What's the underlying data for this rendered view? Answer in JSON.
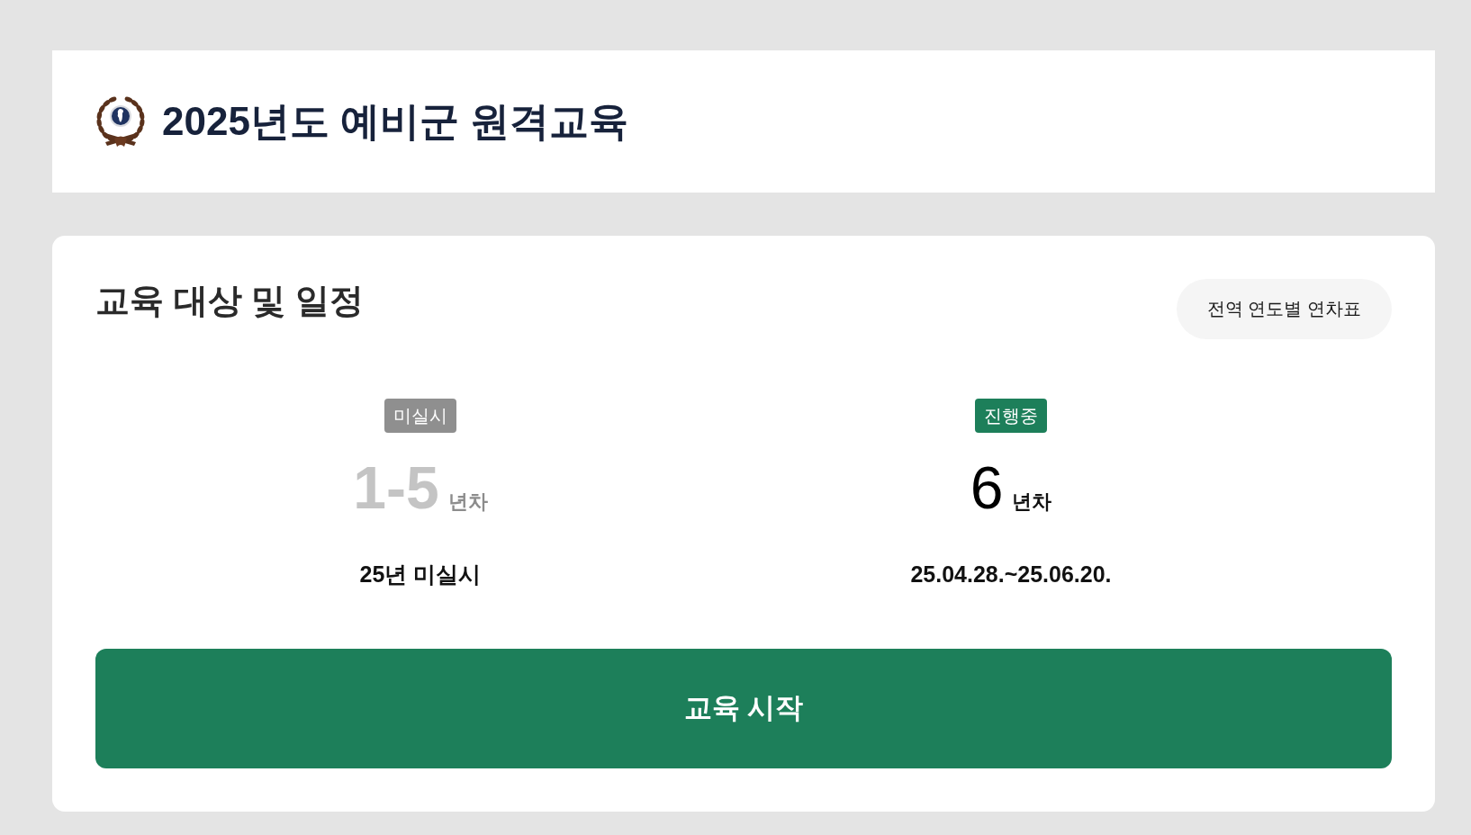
{
  "header": {
    "title": "2025년도 예비군 원격교육"
  },
  "schedule": {
    "heading": "교육 대상 및 일정",
    "chart_button": "전역 연도별 연차표",
    "items": [
      {
        "badge": "미실시",
        "years": "1-5",
        "unit": "년차",
        "period": "25년 미실시",
        "active": false
      },
      {
        "badge": "진행중",
        "years": "6",
        "unit": "년차",
        "period": "25.04.28.~25.06.20.",
        "active": true
      }
    ],
    "start_button": "교육 시작"
  }
}
